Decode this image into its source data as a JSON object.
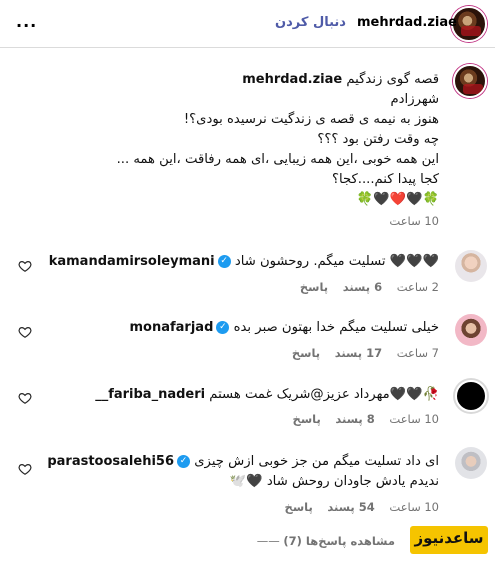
{
  "header": {
    "username": "mehrdad.ziae",
    "follow_label": "دنبال کردن",
    "more_icon": "more-horizontal-icon"
  },
  "caption": {
    "username": "mehrdad.ziae",
    "first_line": "قصه گوی زندگیم",
    "lines": [
      "شهرزادم",
      "هنوز به نیمه ی قصه ی زندگیت نرسیده بودی؟!",
      "چه وقت رفتن بود ؟؟؟",
      "این همه خوبی ،این همه زیبایی ،ای همه رفاقت ،این همه ...",
      "کجا پیدا کنم....کجا؟",
      "🍀🖤❤️🖤🍀"
    ],
    "time": "10 ساعت"
  },
  "comments": [
    {
      "username": "kamandamirsoleymani",
      "verified": true,
      "text": "تسلیت میگم. روحشون شاد 🖤🖤🖤",
      "time": "2 ساعت",
      "likes": "6 پسند",
      "reply": "پاسخ"
    },
    {
      "username": "monafarjad",
      "verified": true,
      "text": "خیلی تسلیت میگم خدا بهتون صبر بده",
      "time": "7 ساعت",
      "likes": "17 پسند",
      "reply": "پاسخ"
    },
    {
      "username": "__fariba_naderi",
      "verified": false,
      "text": "مهرداد عزیز@شریک غمت هستم🖤🖤🥀",
      "time": "10 ساعت",
      "likes": "8 پسند",
      "reply": "پاسخ"
    },
    {
      "username": "parastoosalehi56",
      "verified": true,
      "text_lines": [
        "ای داد تسلیت میگم من جز خوبی ازش چیزی",
        "ندیدم یادش جاودان روحش شاد 🖤🕊️"
      ],
      "time": "10 ساعت",
      "likes": "54 پسند",
      "reply": "پاسخ",
      "view_replies": "مشاهده پاسخ‌ها (7)"
    }
  ],
  "watermark": "ساعدنیوز",
  "colors": {
    "follow": "#4f5ba8",
    "verified": "#1d9bf0",
    "meta": "#737373",
    "watermark_bg": "#f5c400"
  }
}
